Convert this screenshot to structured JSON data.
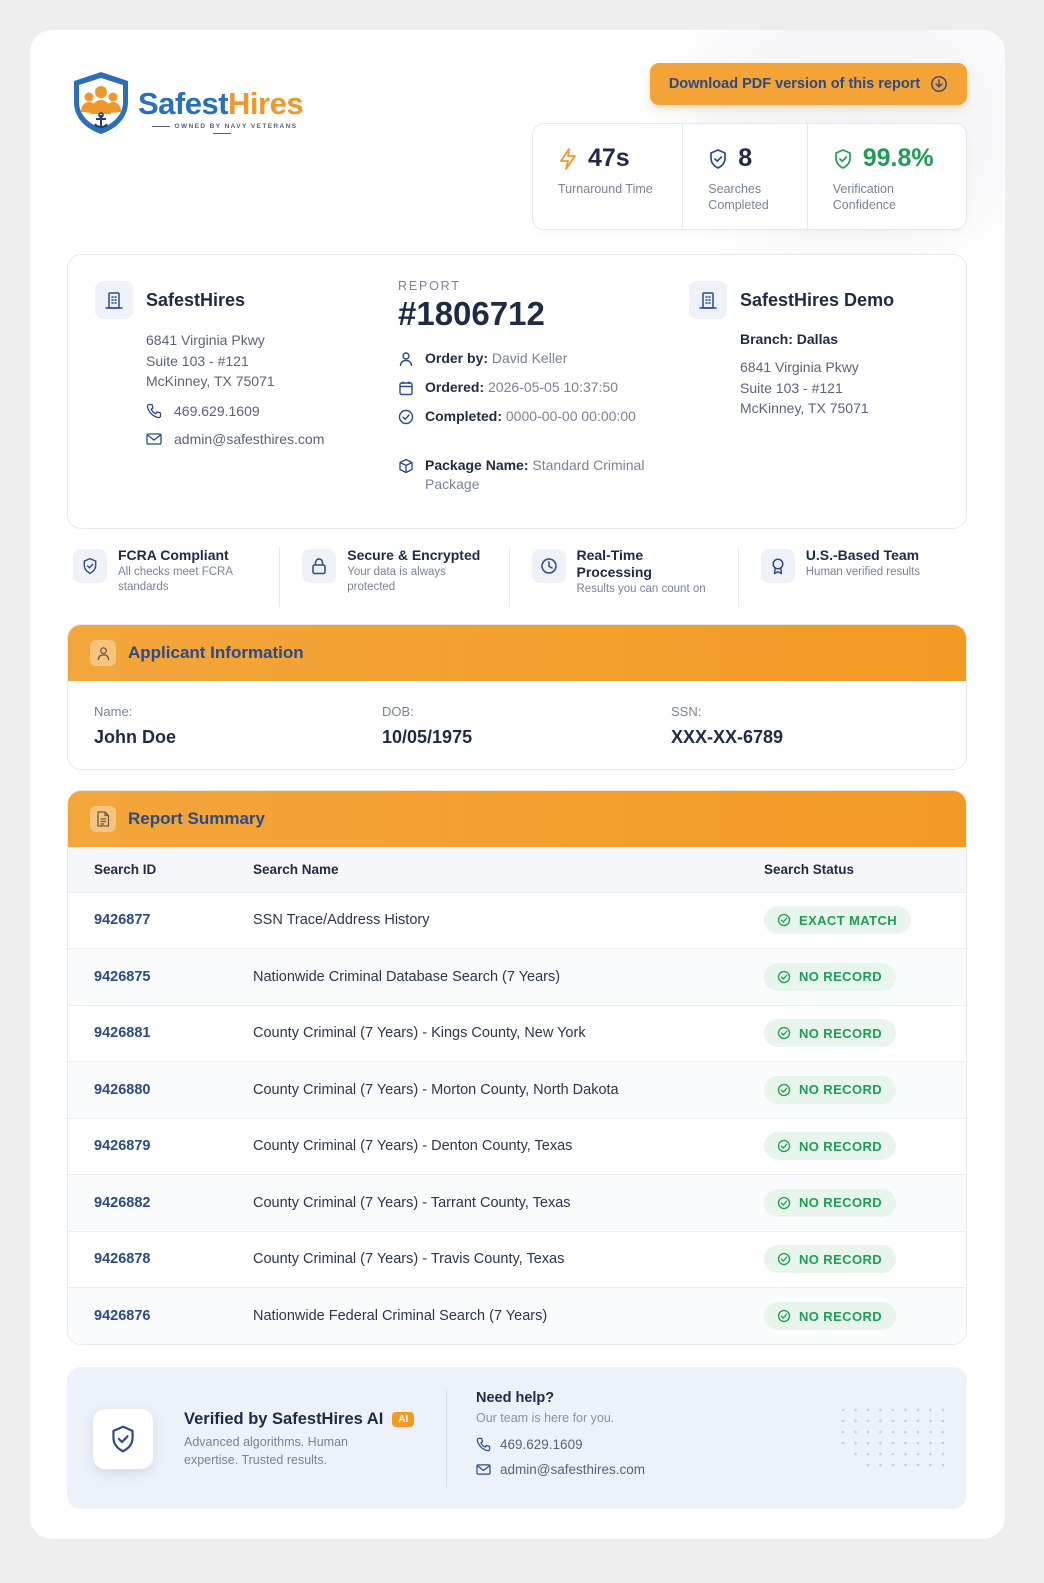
{
  "brand": {
    "name_part1": "Safest",
    "name_part2": "Hires",
    "tagline": "OWNED BY NAVY VETERANS",
    "primary_color": "#2a6fb8",
    "accent_color": "#f0962a"
  },
  "header": {
    "download_label": "Download PDF version of this report",
    "stats": [
      {
        "value": "47s",
        "label": "Turnaround Time",
        "icon": "lightning-icon"
      },
      {
        "value": "8",
        "label": "Searches Completed",
        "icon": "shield-check-icon"
      },
      {
        "value": "99.8%",
        "label": "Verification Confidence",
        "icon": "shield-check-icon"
      }
    ]
  },
  "company": {
    "name": "SafestHires",
    "address_line1": "6841 Virginia Pkwy",
    "address_line2": "Suite 103 - #121",
    "address_line3": "McKinney, TX 75071",
    "phone": "469.629.1609",
    "email": "admin@safesthires.com"
  },
  "report": {
    "label": "REPORT",
    "number": "#1806712",
    "order_by_label": "Order by:",
    "order_by": "David Keller",
    "ordered_label": "Ordered:",
    "ordered": "2026-05-05 10:37:50",
    "completed_label": "Completed:",
    "completed": "0000-00-00 00:00:00",
    "package_label": "Package Name:",
    "package": "Standard Criminal Package"
  },
  "client": {
    "name": "SafestHires Demo",
    "branch": "Branch: Dallas",
    "address_line1": "6841 Virginia Pkwy",
    "address_line2": "Suite 103 - #121",
    "address_line3": "McKinney, TX 75071"
  },
  "features": [
    {
      "title": "FCRA Compliant",
      "sub": "All checks meet FCRA standards",
      "icon": "shield-check-icon"
    },
    {
      "title": "Secure & Encrypted",
      "sub": "Your data is always protected",
      "icon": "lock-icon"
    },
    {
      "title": "Real-Time Processing",
      "sub": "Results you can count on",
      "icon": "clock-icon"
    },
    {
      "title": "U.S.-Based Team",
      "sub": "Human verified results",
      "icon": "award-icon"
    }
  ],
  "applicant": {
    "title": "Applicant Information",
    "name_label": "Name:",
    "name": "John Doe",
    "dob_label": "DOB:",
    "dob": "10/05/1975",
    "ssn_label": "SSN:",
    "ssn": "XXX-XX-6789"
  },
  "summary": {
    "title": "Report Summary",
    "columns": [
      "Search ID",
      "Search Name",
      "Search Status"
    ],
    "rows": [
      {
        "id": "9426877",
        "name": "SSN Trace/Address History",
        "status": "EXACT MATCH"
      },
      {
        "id": "9426875",
        "name": "Nationwide Criminal Database Search (7 Years)",
        "status": "NO RECORD"
      },
      {
        "id": "9426881",
        "name": "County Criminal (7 Years) - Kings County, New York",
        "status": "NO RECORD"
      },
      {
        "id": "9426880",
        "name": "County Criminal (7 Years) - Morton County, North Dakota",
        "status": "NO RECORD"
      },
      {
        "id": "9426879",
        "name": "County Criminal (7 Years) - Denton County, Texas",
        "status": "NO RECORD"
      },
      {
        "id": "9426882",
        "name": "County Criminal (7 Years) - Tarrant County, Texas",
        "status": "NO RECORD"
      },
      {
        "id": "9426878",
        "name": "County Criminal (7 Years) - Travis County, Texas",
        "status": "NO RECORD"
      },
      {
        "id": "9426876",
        "name": "Nationwide Federal Criminal Search (7 Years)",
        "status": "NO RECORD"
      }
    ],
    "status_color": "#1f9d55"
  },
  "footer": {
    "verified_title": "Verified by SafestHires AI",
    "ai_badge": "AI",
    "verified_sub": "Advanced algorithms. Human expertise. Trusted results.",
    "help_title": "Need help?",
    "help_sub": "Our team is here for you.",
    "phone": "469.629.1609",
    "email": "admin@safesthires.com"
  }
}
